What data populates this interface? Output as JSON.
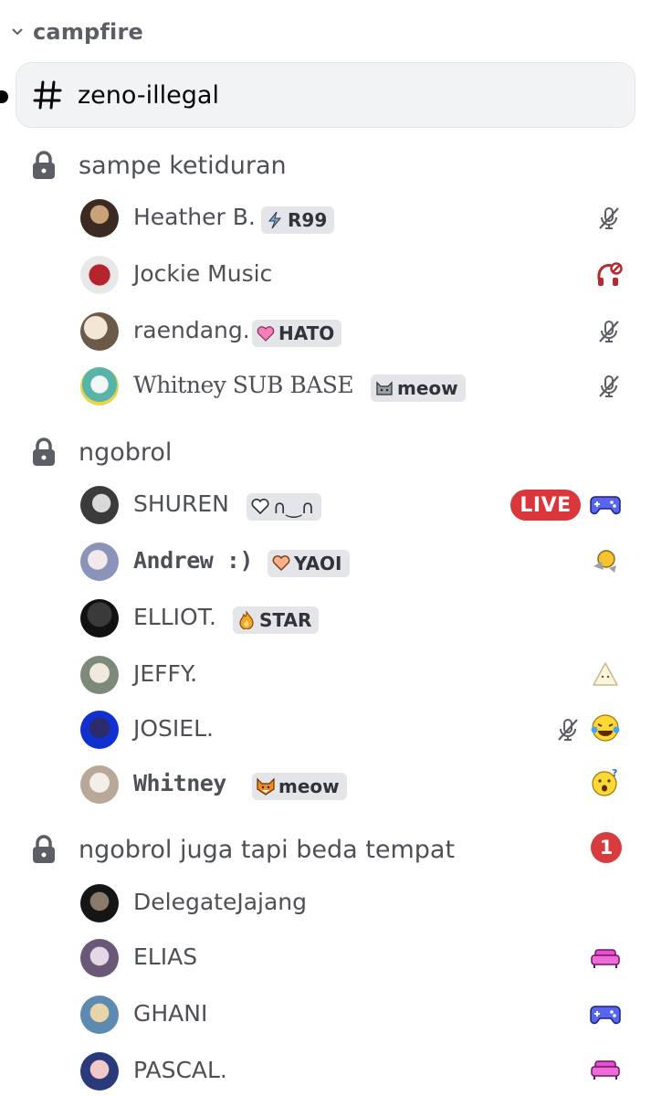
{
  "category": {
    "label": "campfire"
  },
  "active_channel": {
    "label": "zeno-illegal"
  },
  "voice_channels": [
    {
      "label": "sampe ketiduran",
      "members": [
        {
          "name": "Heather B.",
          "tag": "R99",
          "status": "muted"
        },
        {
          "name": "Jockie Music",
          "status": "deafened"
        },
        {
          "name": "raendang.",
          "tag": "HATO",
          "status": "muted"
        },
        {
          "name": "Whitney SUB BASE",
          "tag": "meow",
          "status": "muted"
        }
      ]
    },
    {
      "label": "ngobrol",
      "members": [
        {
          "name": "SHUREN",
          "tag": "∩‿∩",
          "live": "LIVE",
          "activity": "gamepad"
        },
        {
          "name": "Andrew :)",
          "tag": "YAOI",
          "activity": "emoji"
        },
        {
          "name": "ELLIOT.",
          "tag": "STAR"
        },
        {
          "name": "JEFFY.",
          "activity": "emoji"
        },
        {
          "name": "JOSIEL.",
          "status": "muted",
          "activity": "emoji"
        },
        {
          "name": "Whitney",
          "tag": "meow",
          "activity": "emoji"
        }
      ]
    },
    {
      "label": "ngobrol juga tapi beda tempat",
      "badge": "1",
      "members": [
        {
          "name": "DelegateJajang"
        },
        {
          "name": "ELIAS",
          "activity": "couch"
        },
        {
          "name": "GHANI",
          "activity": "gamepad"
        },
        {
          "name": "PASCAL.",
          "activity": "couch"
        }
      ]
    }
  ],
  "colors": {
    "live": "#da373c",
    "badge": "#d83c3e",
    "text": "#4e5058",
    "pill": "#e3e5e8"
  }
}
